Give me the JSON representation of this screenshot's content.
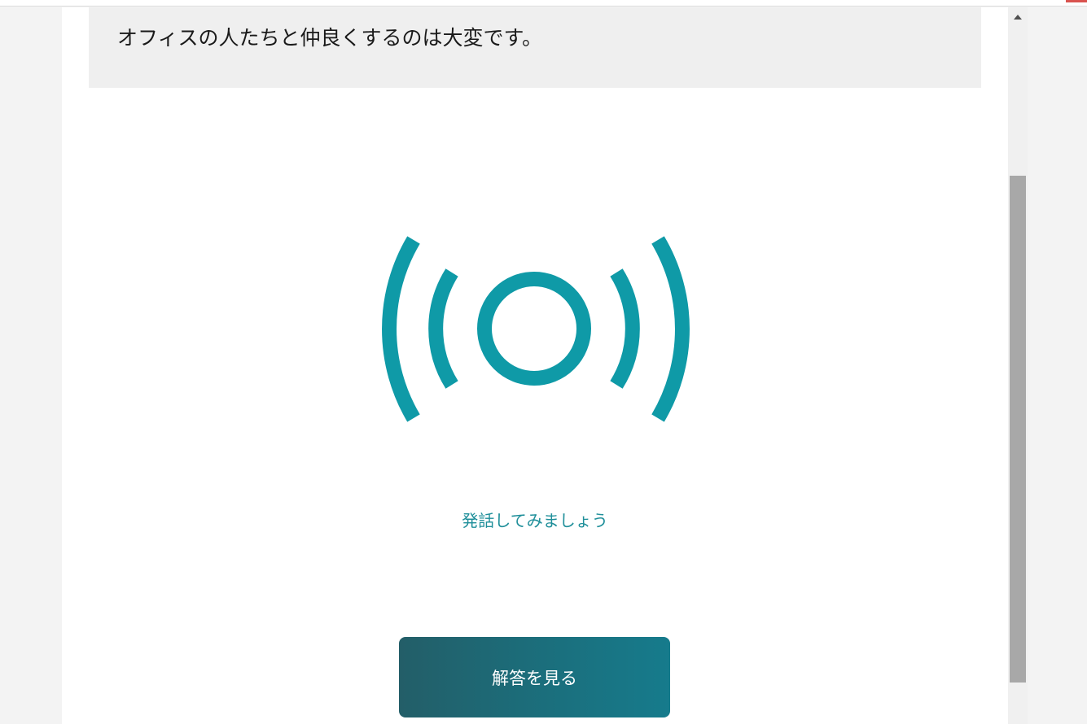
{
  "prompt": {
    "text": "オフィスの人たちと仲良くするのは大変です。"
  },
  "mic": {
    "icon": "broadcast-speaking-icon",
    "color": "#0f9aa7"
  },
  "hint": {
    "text": "発話してみましょう"
  },
  "actions": {
    "answer_label": "解答を見る"
  },
  "colors": {
    "accent": "#0f9aa7",
    "button_start": "#235e68",
    "button_end": "#167b8c",
    "prompt_bg": "#efefef"
  }
}
